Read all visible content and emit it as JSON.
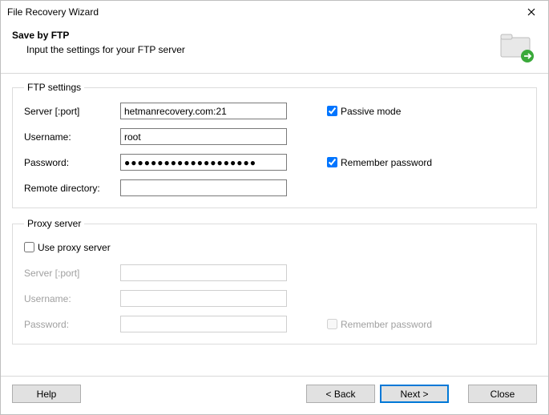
{
  "window": {
    "title": "File Recovery Wizard"
  },
  "header": {
    "title": "Save by FTP",
    "subtitle": "Input the settings for your FTP server"
  },
  "ftp": {
    "legend": "FTP settings",
    "server_label": "Server [:port]",
    "server_value": "hetmanrecovery.com:21",
    "username_label": "Username:",
    "username_value": "root",
    "password_label": "Password:",
    "password_value": "●●●●●●●●●●●●●●●●●●●●",
    "remote_dir_label": "Remote directory:",
    "remote_dir_value": "",
    "passive_label": "Passive mode",
    "passive_checked": true,
    "remember_label": "Remember password",
    "remember_checked": true
  },
  "proxy": {
    "legend": "Proxy server",
    "use_proxy_label": "Use proxy server",
    "use_proxy_checked": false,
    "server_label": "Server [:port]",
    "server_value": "",
    "username_label": "Username:",
    "username_value": "",
    "password_label": "Password:",
    "password_value": "",
    "remember_label": "Remember password",
    "remember_checked": false
  },
  "footer": {
    "help": "Help",
    "back": "< Back",
    "next": "Next >",
    "close": "Close"
  }
}
